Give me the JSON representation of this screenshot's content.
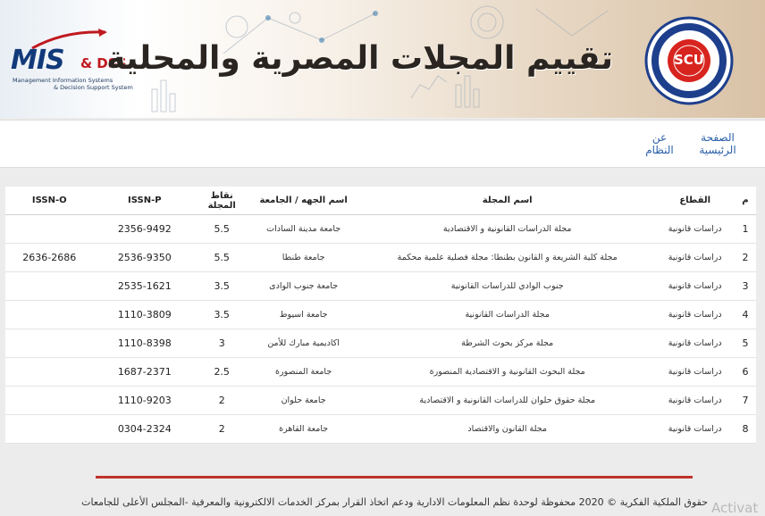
{
  "banner": {
    "title": "تقييم المجلات المصرية والمحلية",
    "logo_left": {
      "main": "MIS",
      "accent": "& DSS",
      "line1": "Management Information Systems",
      "line2": "& Decision Support System"
    },
    "seal_label": "SCU",
    "seal_text_top": "المجلس الأعلى للجامعات",
    "seal_text_bottom": "SUPREME COUNCIL OF UNIVERSITIES"
  },
  "nav": {
    "home": "الصفحة الرئيسية",
    "about": "عن النظام"
  },
  "table": {
    "headers": {
      "index": "م",
      "sector": "القطاع",
      "name": "اسم المجلة",
      "university": "اسم الجهه / الجامعة",
      "points": "نقاط المجلة",
      "issn_p": "ISSN-P",
      "issn_o": "ISSN-O"
    },
    "rows": [
      {
        "index": "1",
        "sector": "دراسات قانونية",
        "name": "مجلة الدراسات القانونية و الاقتصادية",
        "university": "جامعة مدينة السادات",
        "points": "5.5",
        "issn_p": "2356-9492",
        "issn_o": ""
      },
      {
        "index": "2",
        "sector": "دراسات قانونية",
        "name": "مجلة كلية الشريعة و القانون بطنطا: مجلة فصلية علمية محكمة",
        "university": "جامعة طنطا",
        "points": "5.5",
        "issn_p": "2536-9350",
        "issn_o": "2636-2686"
      },
      {
        "index": "3",
        "sector": "دراسات قانونية",
        "name": "جنوب الوادي للدراسات القانونية",
        "university": "جامعة جنوب الوادى",
        "points": "3.5",
        "issn_p": "2535-1621",
        "issn_o": ""
      },
      {
        "index": "4",
        "sector": "دراسات قانونية",
        "name": "مجلة الدراسات القانونية",
        "university": "جامعة اسيوط",
        "points": "3.5",
        "issn_p": "1110-3809",
        "issn_o": ""
      },
      {
        "index": "5",
        "sector": "دراسات قانونية",
        "name": "مجلة مركز بحوث الشرطة",
        "university": "اكاديمية مبارك للأمن",
        "points": "3",
        "issn_p": "1110-8398",
        "issn_o": ""
      },
      {
        "index": "6",
        "sector": "دراسات قانونية",
        "name": "مجلة البحوث القانونية و الاقتصادية المنصورة",
        "university": "جامعة المنصورة",
        "points": "2.5",
        "issn_p": "1687-2371",
        "issn_o": ""
      },
      {
        "index": "7",
        "sector": "دراسات قانونية",
        "name": "مجلة حقوق حلوان للدراسات القانونية و الاقتصادية",
        "university": "جامعة حلوان",
        "points": "2",
        "issn_p": "1110-9203",
        "issn_o": ""
      },
      {
        "index": "8",
        "sector": "دراسات قانونية",
        "name": "مجلة القانون والاقتصاد",
        "university": "جامعة القاهرة",
        "points": "2",
        "issn_p": "0304-2324",
        "issn_o": ""
      }
    ]
  },
  "footer": {
    "copyright": "حقوق الملكية الفكرية © 2020 محفوظة لوحدة نظم المعلومات الادارية ودعم اتخاذ القرار بمركز الخدمات الالكترونية والمعرفية -المجلس الأعلى للجامعات",
    "watermark": "Activat"
  },
  "colors": {
    "link": "#2a5ea8",
    "footer_rule": "#c0332b",
    "mis_blue": "#123a7a",
    "dss_red": "#c0191f",
    "seal_blue": "#1e3f8c",
    "seal_red": "#d8241f"
  }
}
